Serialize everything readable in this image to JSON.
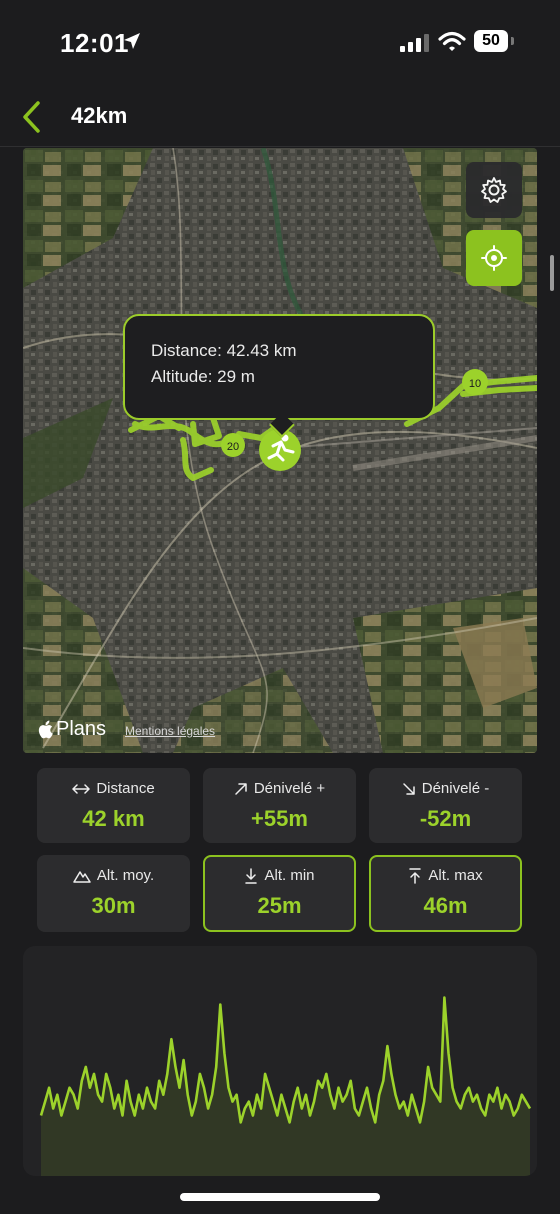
{
  "status_bar": {
    "time": "12:01",
    "battery_level": "50"
  },
  "nav": {
    "title": "42km"
  },
  "map": {
    "tooltip": {
      "distance": "Distance: 42.43 km",
      "altitude": "Altitude: 29 m"
    },
    "markers": [
      "10",
      "20"
    ],
    "attribution": {
      "logo": "Plans",
      "legal": "Mentions légales"
    },
    "accent_color": "#8cc21f"
  },
  "stats": [
    {
      "label": "Distance",
      "value": "42 km",
      "icon": "arrows-horizontal-icon"
    },
    {
      "label": "Dénivelé +",
      "value": "+55m",
      "icon": "arrow-up-right-icon"
    },
    {
      "label": "Dénivelé -",
      "value": "-52m",
      "icon": "arrow-down-right-icon"
    },
    {
      "label": "Alt. moy.",
      "value": "30m",
      "icon": "mountain-icon"
    },
    {
      "label": "Alt. min",
      "value": "25m",
      "icon": "arrow-down-icon"
    },
    {
      "label": "Alt. max",
      "value": "46m",
      "icon": "arrow-up-icon"
    }
  ],
  "chart_data": {
    "type": "line",
    "title": "",
    "xlabel": "",
    "ylabel": "",
    "x": [
      0,
      1,
      2,
      3,
      4,
      5,
      6,
      7,
      8,
      9,
      10,
      11,
      12,
      13,
      14,
      15,
      16,
      17,
      18,
      19,
      20,
      21,
      22,
      23,
      24,
      25,
      26,
      27,
      28,
      29,
      30,
      31,
      32,
      33,
      34,
      35,
      36,
      37,
      38,
      39,
      40,
      41,
      42,
      43,
      44,
      45,
      46,
      47,
      48,
      49,
      50,
      51,
      52,
      53,
      54,
      55,
      56,
      57,
      58,
      59,
      60,
      61,
      62,
      63,
      64,
      65,
      66,
      67,
      68,
      69,
      70,
      71,
      72,
      73,
      74,
      75,
      76,
      77,
      78,
      79,
      80,
      81,
      82,
      83,
      84,
      85,
      86,
      87,
      88,
      89,
      90,
      91,
      92,
      93,
      94,
      95,
      96,
      97,
      98,
      99,
      100,
      101,
      102,
      103,
      104,
      105,
      106,
      107,
      108,
      109,
      110,
      111,
      112,
      113,
      114,
      115,
      116,
      117,
      118,
      119,
      120
    ],
    "values": [
      27,
      29,
      31,
      28,
      30,
      27,
      29,
      31,
      30,
      28,
      32,
      34,
      31,
      33,
      30,
      29,
      33,
      31,
      28,
      30,
      27,
      32,
      29,
      27,
      30,
      28,
      31,
      29,
      28,
      32,
      30,
      33,
      38,
      34,
      31,
      35,
      30,
      27,
      29,
      33,
      31,
      28,
      30,
      34,
      43,
      36,
      31,
      29,
      30,
      26,
      28,
      29,
      27,
      30,
      28,
      33,
      31,
      29,
      27,
      30,
      28,
      26,
      29,
      31,
      28,
      30,
      27,
      29,
      32,
      31,
      33,
      30,
      28,
      31,
      29,
      30,
      32,
      28,
      27,
      29,
      31,
      28,
      26,
      30,
      32,
      37,
      33,
      30,
      28,
      29,
      27,
      30,
      28,
      26,
      29,
      34,
      31,
      30,
      29,
      44,
      36,
      31,
      29,
      28,
      30,
      31,
      29,
      30,
      28,
      27,
      30,
      29,
      31,
      28,
      30,
      29,
      27,
      28,
      30,
      29,
      28
    ],
    "ylim": [
      20,
      50
    ],
    "line_color": "#9cd22b"
  }
}
